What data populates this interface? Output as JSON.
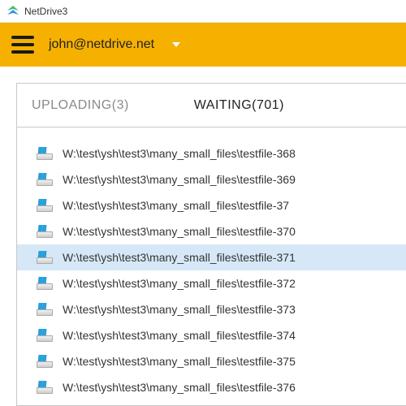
{
  "window": {
    "title": "NetDrive3"
  },
  "header": {
    "user_email": "john@netdrive.net"
  },
  "tabs": {
    "uploading": {
      "label": "UPLOADING",
      "count": 3
    },
    "waiting": {
      "label": "WAITING",
      "count": 701
    },
    "active": "waiting"
  },
  "file_path_prefix": "W:\\test\\ysh\\test3\\many_small_files\\testfile-",
  "files": [
    {
      "suffix": "368",
      "selected": false
    },
    {
      "suffix": "369",
      "selected": false
    },
    {
      "suffix": "37",
      "selected": false
    },
    {
      "suffix": "370",
      "selected": false
    },
    {
      "suffix": "371",
      "selected": true
    },
    {
      "suffix": "372",
      "selected": false
    },
    {
      "suffix": "373",
      "selected": false
    },
    {
      "suffix": "374",
      "selected": false
    },
    {
      "suffix": "375",
      "selected": false
    },
    {
      "suffix": "376",
      "selected": false
    }
  ]
}
